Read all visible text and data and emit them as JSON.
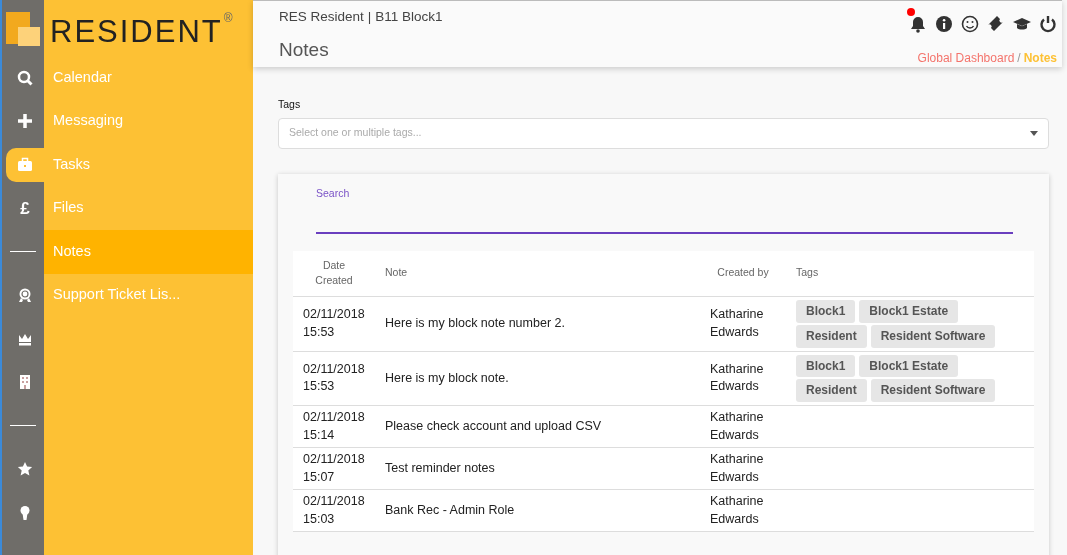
{
  "brand": {
    "name": "RESIDENT",
    "mark": "®"
  },
  "rail": [
    {
      "kind": "icon",
      "selected": false
    },
    {
      "kind": "icon",
      "selected": false
    },
    {
      "kind": "icon",
      "selected": true
    },
    {
      "kind": "glyph",
      "text": "£",
      "selected": false
    },
    {
      "kind": "divider"
    },
    {
      "kind": "icon",
      "selected": false
    },
    {
      "kind": "icon",
      "selected": false
    },
    {
      "kind": "icon",
      "selected": false
    },
    {
      "kind": "divider"
    },
    {
      "kind": "icon",
      "selected": false
    },
    {
      "kind": "icon",
      "selected": false
    }
  ],
  "sidebar": {
    "items": [
      {
        "label": "Calendar",
        "selected": false
      },
      {
        "label": "Messaging",
        "selected": false
      },
      {
        "label": "Tasks",
        "selected": false
      },
      {
        "label": "Files",
        "selected": false
      },
      {
        "label": "Notes",
        "selected": true
      },
      {
        "label": "Support Ticket Lis...",
        "selected": false
      }
    ]
  },
  "header": {
    "context": "RES Resident",
    "separator": "|",
    "block": "B11 Block1",
    "title": "Notes",
    "notification": true,
    "breadcrumb": [
      {
        "label": "Global Dashboard",
        "selected": false
      },
      {
        "label": "/",
        "kind": "separator"
      },
      {
        "label": "Notes",
        "selected": true
      }
    ]
  },
  "filter": {
    "label": "Tags",
    "placeholder": "Select one or multiple tags..."
  },
  "search": {
    "label": "Search"
  },
  "table": {
    "columns": [
      "Date Created",
      "Note",
      "Created by",
      "Tags"
    ],
    "rows": [
      {
        "date": "02/11/2018 15:53",
        "note": "Here is my block note number 2.",
        "created_by": "Katharine Edwards",
        "tags": [
          "Block1",
          "Block1 Estate",
          "Resident",
          "Resident Software"
        ]
      },
      {
        "date": "02/11/2018 15:53",
        "note": "Here is my block note.",
        "created_by": "Katharine Edwards",
        "tags": [
          "Block1",
          "Block1 Estate",
          "Resident",
          "Resident Software"
        ]
      },
      {
        "date": "02/11/2018 15:14",
        "note": "Please check account and upload CSV",
        "created_by": "Katharine Edwards"
      },
      {
        "date": "02/11/2018 15:07",
        "note": "Test reminder notes",
        "created_by": "Katharine Edwards"
      },
      {
        "date": "02/11/2018 15:03",
        "note": "Bank Rec - Admin Role",
        "created_by": "Katharine Edwards"
      }
    ]
  }
}
